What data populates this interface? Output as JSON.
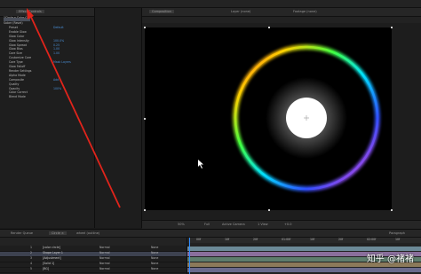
{
  "topbar": {
    "items": [
      "",
      "",
      ""
    ]
  },
  "effect_controls": {
    "tab_label": "Effect Controls",
    "title": "1Circle • Color Circ",
    "rows": [
      {
        "label": "Saber (Reset)",
        "value": ""
      },
      {
        "label": "Preset",
        "value": "Default"
      },
      {
        "label": "Enable Glow",
        "value": ""
      },
      {
        "label": "Glow Color",
        "value": ""
      },
      {
        "label": "Glow Intensity",
        "value": "100.0%"
      },
      {
        "label": "Glow Spread",
        "value": "0.25"
      },
      {
        "label": "Glow Bias",
        "value": "1.00"
      },
      {
        "label": "Core Size",
        "value": "1.00"
      },
      {
        "label": "Customize Core",
        "value": ""
      },
      {
        "label": "Core Type",
        "value": "Mask Layers"
      },
      {
        "label": "Glow Falloff",
        "value": ""
      },
      {
        "label": "Render Settings",
        "value": ""
      },
      {
        "label": "Alpha Mode",
        "value": ""
      },
      {
        "label": "Composite",
        "value": "Add"
      },
      {
        "label": "Quality",
        "value": ""
      },
      {
        "label": "Opacity",
        "value": "100%"
      },
      {
        "label": "Color Correct",
        "value": ""
      },
      {
        "label": "Blend Mode",
        "value": ""
      }
    ]
  },
  "composition": {
    "tab_label": "Composition",
    "sub_tabs": [
      "Layer (none)",
      "Footage (none)"
    ],
    "footer": [
      "50%",
      "Full",
      "Active Camera",
      "1 View",
      "+0.0"
    ]
  },
  "timeline": {
    "tabs": [
      "Render Queue",
      "Circle ×",
      "wheel (outline)"
    ],
    "layers": [
      {
        "num": "1",
        "name": "[color circle]",
        "mode": "Normal",
        "parent": "None"
      },
      {
        "num": "2",
        "name": "Shape Layer 1",
        "mode": "Normal",
        "parent": "None"
      },
      {
        "num": "3",
        "name": "[Adjustment]",
        "mode": "Normal",
        "parent": "None"
      },
      {
        "num": "4",
        "name": "[Solid 1]",
        "mode": "Normal",
        "parent": "None"
      },
      {
        "num": "5",
        "name": "[BG]",
        "mode": "Normal",
        "parent": "None"
      }
    ],
    "ruler_labels": [
      "00f",
      "10f",
      "20f",
      "01:00f",
      "10f",
      "20f",
      "02:00f",
      "10f"
    ],
    "paragraph_label": "Paragraph"
  },
  "watermark": "知乎 @褚褚",
  "colors": {
    "accent": "#2f8cff",
    "annotation": "#e0241b",
    "panel": "#1e1e1e"
  },
  "icons": [
    "arrow-annotation-icon",
    "cursor-icon",
    "crosshair-icon"
  ]
}
